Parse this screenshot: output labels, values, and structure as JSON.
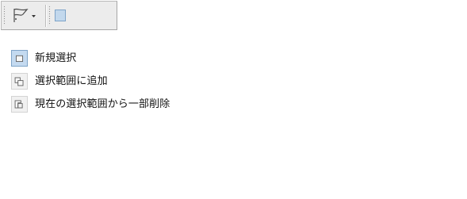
{
  "toolbar": {
    "tool_preset_icon": "flag-selection-tool-icon",
    "dropdown_icon": "caret-down-icon",
    "mode_buttons": [
      {
        "name": "new-selection",
        "icon": "new-selection-icon",
        "selected": true
      },
      {
        "name": "add-to-selection",
        "icon": "add-to-selection-icon",
        "selected": false
      },
      {
        "name": "subtract-from-selection",
        "icon": "subtract-from-selection-icon",
        "selected": false
      },
      {
        "name": "intersect-selection",
        "icon": "intersect-selection-icon",
        "selected": false
      }
    ]
  },
  "legend": {
    "items": [
      {
        "label": "新規選択",
        "icon": "new-selection-icon",
        "selected": true
      },
      {
        "label": "選択範囲に追加",
        "icon": "add-to-selection-icon",
        "selected": false
      },
      {
        "label": "現在の選択範囲から一部削除",
        "icon": "subtract-from-selection-icon",
        "selected": false
      }
    ]
  },
  "colors": {
    "toolbar_background": "#ececec",
    "selected_background": "#c4daf0",
    "selected_border": "#7ea4c8",
    "icon_border": "#5f5f5f"
  }
}
